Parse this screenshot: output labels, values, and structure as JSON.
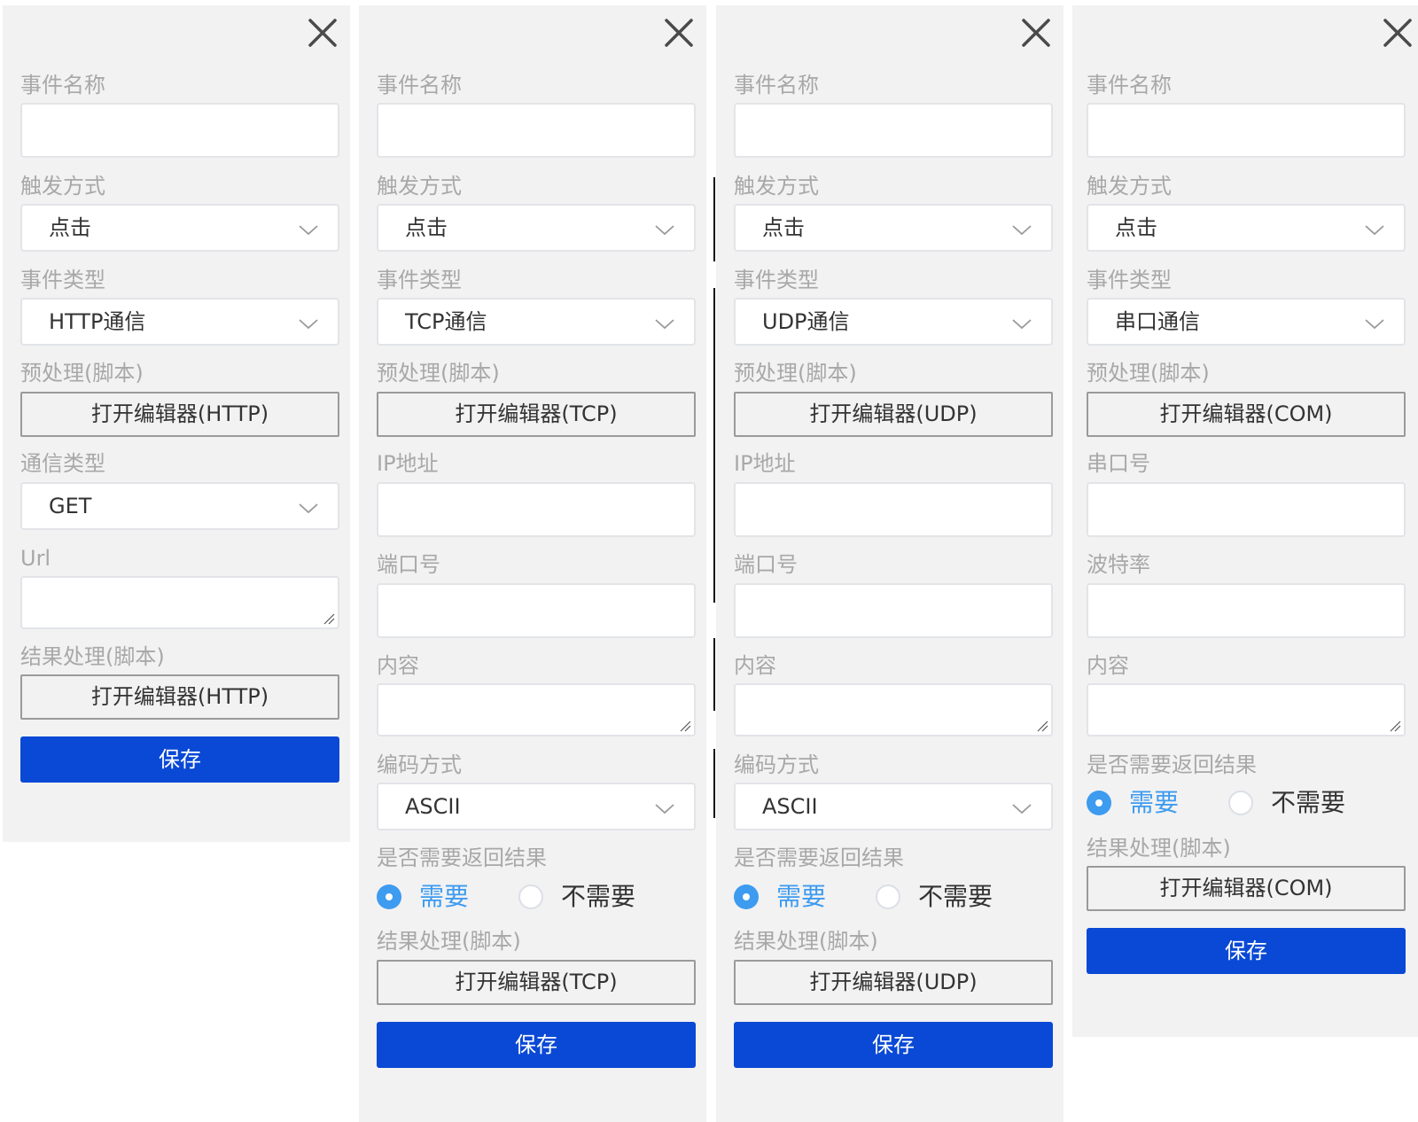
{
  "common": {
    "event_name_label": "事件名称",
    "trigger_label": "触发方式",
    "trigger_value": "点击",
    "event_type_label": "事件类型",
    "preprocess_label": "预处理(脚本)",
    "result_process_label": "结果处理(脚本)",
    "save_label": "保存",
    "need_result_label": "是否需要返回结果",
    "need_yes": "需要",
    "need_no": "不需要"
  },
  "panels": {
    "http": {
      "event_type_value": "HTTP通信",
      "editor_button": "打开编辑器(HTTP)",
      "comm_type_label": "通信类型",
      "comm_type_value": "GET",
      "url_label": "Url"
    },
    "tcp": {
      "event_type_value": "TCP通信",
      "editor_button": "打开编辑器(TCP)",
      "ip_label": "IP地址",
      "port_label": "端口号",
      "content_label": "内容",
      "encoding_label": "编码方式",
      "encoding_value": "ASCII"
    },
    "udp": {
      "event_type_value": "UDP通信",
      "editor_button": "打开编辑器(UDP)",
      "ip_label": "IP地址",
      "port_label": "端口号",
      "content_label": "内容",
      "encoding_label": "编码方式",
      "encoding_value": "ASCII"
    },
    "com": {
      "event_type_value": "串口通信",
      "editor_button": "打开编辑器(COM)",
      "serial_label": "串口号",
      "baud_label": "波特率",
      "content_label": "内容"
    }
  },
  "icons": {
    "close": "close-icon",
    "dropdown": "chevron-down-icon",
    "resize": "resize-handle-icon",
    "radio_checked": "radio-checked-icon"
  },
  "colors": {
    "panel_bg": "#f2f2f2",
    "label": "#a8a8a8",
    "primary_button": "#0a49d5",
    "radio_active": "#3d9bf0"
  }
}
